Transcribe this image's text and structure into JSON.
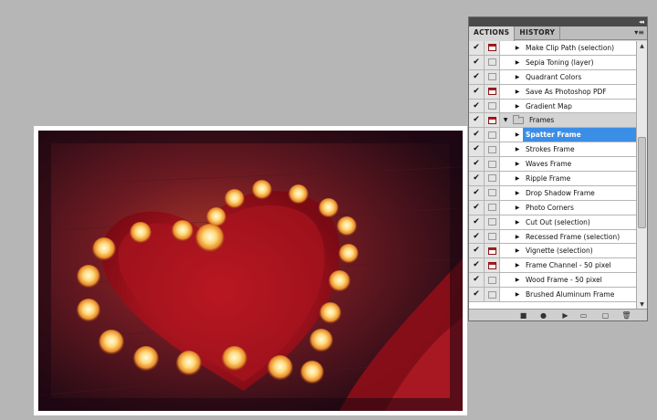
{
  "panel": {
    "collapse_label": "◂◂",
    "menu_label": "▾≡",
    "tabs": [
      {
        "label": "ACTIONS",
        "active": true
      },
      {
        "label": "HISTORY",
        "active": false
      }
    ],
    "rows": [
      {
        "label": "Make Clip Path (selection)",
        "checked": true,
        "dialog": true,
        "type": "action"
      },
      {
        "label": "Sepia Toning (layer)",
        "checked": true,
        "dialog": false,
        "type": "action"
      },
      {
        "label": "Quadrant Colors",
        "checked": true,
        "dialog": false,
        "type": "action"
      },
      {
        "label": "Save As Photoshop PDF",
        "checked": true,
        "dialog": true,
        "type": "action"
      },
      {
        "label": "Gradient Map",
        "checked": true,
        "dialog": false,
        "type": "action"
      },
      {
        "label": "Frames",
        "checked": true,
        "dialog": true,
        "type": "folder"
      },
      {
        "label": "Spatter Frame",
        "checked": true,
        "dialog": false,
        "type": "action",
        "selected": true
      },
      {
        "label": "Strokes Frame",
        "checked": true,
        "dialog": false,
        "type": "action"
      },
      {
        "label": "Waves Frame",
        "checked": true,
        "dialog": false,
        "type": "action"
      },
      {
        "label": "Ripple Frame",
        "checked": true,
        "dialog": false,
        "type": "action"
      },
      {
        "label": "Drop Shadow Frame",
        "checked": true,
        "dialog": false,
        "type": "action"
      },
      {
        "label": "Photo Corners",
        "checked": true,
        "dialog": false,
        "type": "action"
      },
      {
        "label": "Cut Out (selection)",
        "checked": true,
        "dialog": false,
        "type": "action"
      },
      {
        "label": "Recessed Frame (selection)",
        "checked": true,
        "dialog": false,
        "type": "action"
      },
      {
        "label": "Vignette (selection)",
        "checked": true,
        "dialog": true,
        "type": "action"
      },
      {
        "label": "Frame Channel - 50 pixel",
        "checked": true,
        "dialog": true,
        "type": "action"
      },
      {
        "label": "Wood Frame - 50 pixel",
        "checked": true,
        "dialog": false,
        "type": "action"
      },
      {
        "label": "Brushed Aluminum Frame",
        "checked": true,
        "dialog": false,
        "type": "action"
      }
    ],
    "toolbar": {
      "stop_icon": "■",
      "record_icon": "●",
      "play_icon": "▶",
      "new_set_icon": "▭",
      "new_action_icon": "▢",
      "delete_icon": "🗑"
    },
    "scroll": {
      "up": "▲",
      "down": "▼"
    },
    "check_glyph": "✔",
    "collapsed_glyph": "▶",
    "expanded_glyph": "▼"
  },
  "colors": {
    "selection": "#3b8ee6",
    "dialog_on": "#b21a1a",
    "canvas_bg": "#b6b6b6"
  }
}
